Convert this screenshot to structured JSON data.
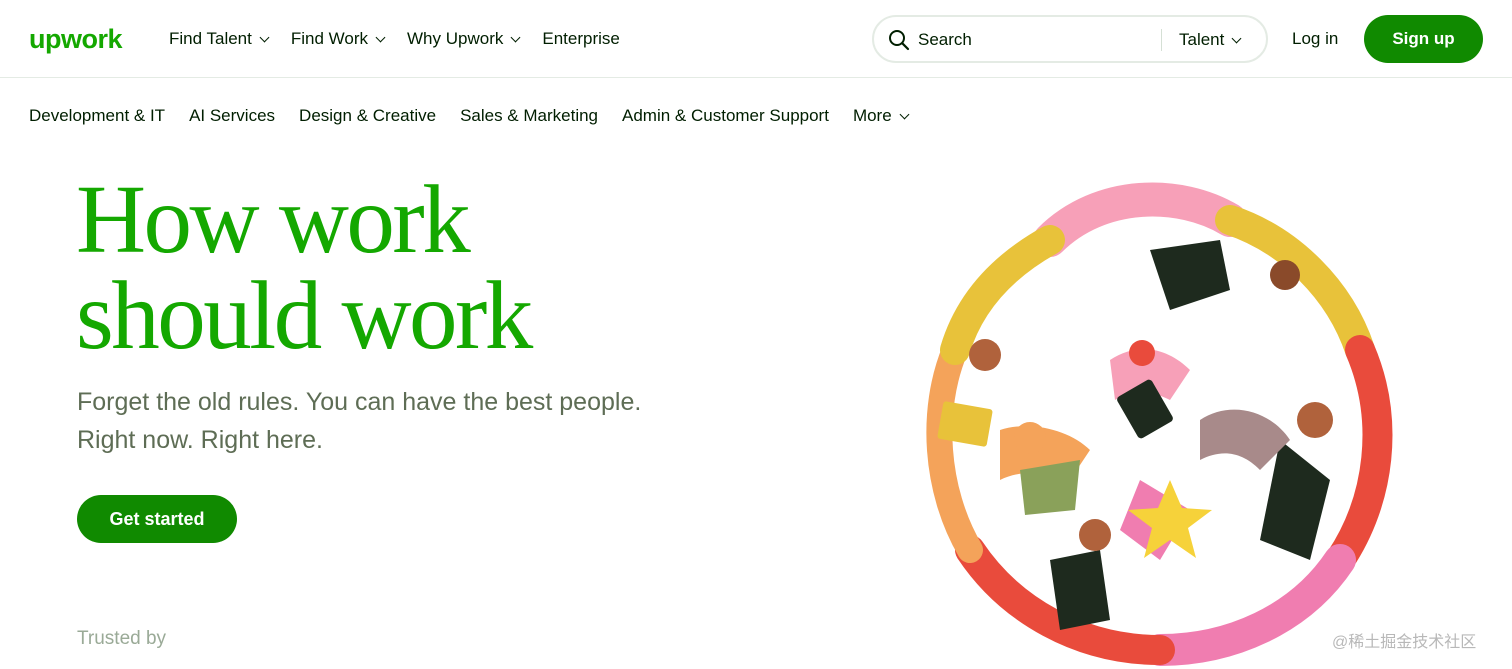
{
  "brand": {
    "logo_text": "upwork",
    "color": "#14a800",
    "button_green": "#108a00"
  },
  "header": {
    "nav": [
      {
        "label": "Find Talent",
        "has_dropdown": true
      },
      {
        "label": "Find Work",
        "has_dropdown": true
      },
      {
        "label": "Why Upwork",
        "has_dropdown": true
      },
      {
        "label": "Enterprise",
        "has_dropdown": false
      }
    ],
    "search": {
      "placeholder": "Search",
      "scope_label": "Talent",
      "icon": "search-icon"
    },
    "login_label": "Log in",
    "signup_label": "Sign up"
  },
  "categories": [
    "Development & IT",
    "AI Services",
    "Design & Creative",
    "Sales & Marketing",
    "Admin & Customer Support"
  ],
  "categories_more": "More",
  "hero": {
    "title_line1": "How work",
    "title_line2": "should work",
    "subtitle_line1": "Forget the old rules. You can have the best people.",
    "subtitle_line2": "Right now. Right here.",
    "cta_label": "Get started",
    "trusted_label": "Trusted by"
  },
  "watermark": "@稀土掘金技术社区"
}
